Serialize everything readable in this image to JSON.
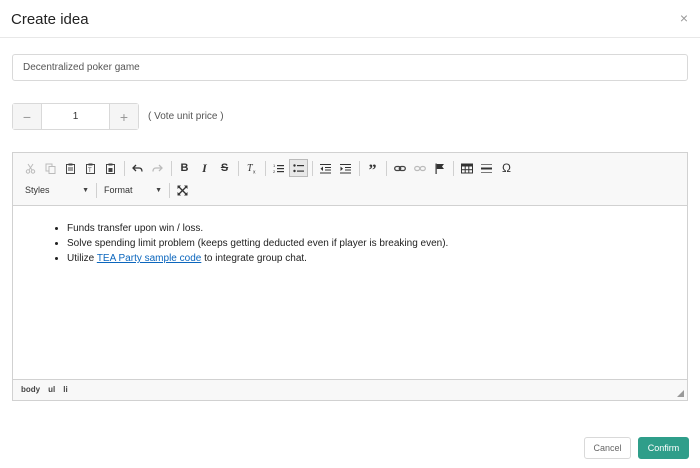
{
  "dialog": {
    "title": "Create idea",
    "close_glyph": "×"
  },
  "form": {
    "name_value": "Decentralized poker game",
    "stepper": {
      "minus": "−",
      "value": "1",
      "plus": "+",
      "label": "( Vote unit price )"
    }
  },
  "editor": {
    "styles_label": "Styles",
    "format_label": "Format",
    "content": {
      "item1": "Funds transfer upon win / loss.",
      "item2": "Solve spending limit problem (keeps getting deducted even if player is breaking even).",
      "item3_prefix": "Utilize ",
      "item3_link": "TEA Party sample code",
      "item3_suffix": " to integrate group chat."
    },
    "path": [
      "body",
      "ul",
      "li"
    ],
    "toolbar_icons": [
      "cut-icon",
      "copy-icon",
      "paste-icon",
      "paste-text-icon",
      "paste-word-icon",
      "undo-icon",
      "redo-icon",
      "bold-icon",
      "italic-icon",
      "strike-icon",
      "remove-format-icon",
      "numbered-list-icon",
      "bulleted-list-icon",
      "outdent-icon",
      "indent-icon",
      "blockquote-icon",
      "link-icon",
      "unlink-icon",
      "anchor-icon",
      "table-icon",
      "horizontal-rule-icon",
      "special-char-icon",
      "maximize-icon"
    ]
  },
  "actions": {
    "cancel": "Cancel",
    "confirm": "Confirm"
  },
  "colors": {
    "accent": "#2f9e8a",
    "link": "#0b66bd"
  }
}
